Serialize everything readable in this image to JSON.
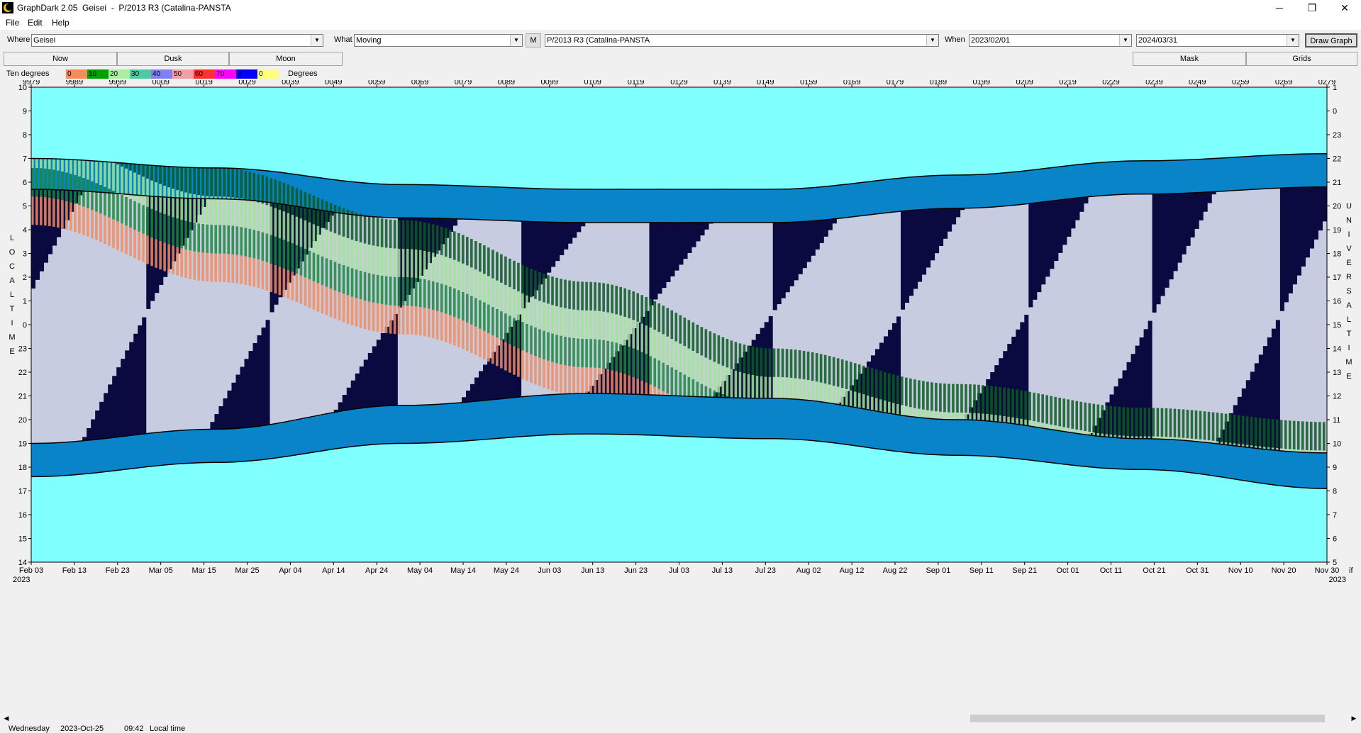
{
  "window": {
    "title": "GraphDark 2.05  Geisei  -  P/2013 R3 (Catalina-PANSTA",
    "minimize_glyph": "─",
    "maximize_glyph": "❐",
    "close_glyph": "✕"
  },
  "menu": [
    "File",
    "Edit",
    "Help"
  ],
  "toolbar": {
    "where_label": "Where",
    "where_value": "Geisei",
    "what_label": "What",
    "what_value": "Moving",
    "m_button": "M",
    "object_value": "P/2013 R3 (Catalina-PANSTA",
    "when_label": "When",
    "when_start": "2023/02/01",
    "when_end": "2024/03/31",
    "draw_button": "Draw Graph"
  },
  "tabs": [
    "Now",
    "Dusk",
    "Moon",
    "Mask",
    "Grids"
  ],
  "legend": {
    "label": "Ten degrees",
    "units": "Degrees",
    "steps": [
      {
        "label": "0",
        "color": "#f28c5f"
      },
      {
        "label": "10",
        "color": "#00a000"
      },
      {
        "label": "20",
        "color": "#a8f0a0"
      },
      {
        "label": "30",
        "color": "#50c8a0"
      },
      {
        "label": "40",
        "color": "#8080f0"
      },
      {
        "label": "50",
        "color": "#f0a0a0"
      },
      {
        "label": "60",
        "color": "#ff3030"
      },
      {
        "label": "70",
        "color": "#ff00ff"
      },
      {
        "label": "8",
        "color": "#0000ff"
      },
      {
        "label": "0",
        "color": "#ffff80"
      }
    ]
  },
  "chart_data": {
    "type": "heatmap",
    "colors": {
      "daylight": "#80ffff",
      "twilight": "#0a84c8",
      "dark_sky": "#0a0a40",
      "moonlit": "#c8cce0",
      "alt_0_10": "#f28c5f",
      "alt_10_20": "#1a8a3a",
      "alt_20_30": "#a0e890",
      "alt_30_plus": "#0a5a20"
    },
    "jd_prefix_left": "2450000+",
    "jd_prefix_right": "2460000+",
    "jd_labels": [
      "9979",
      "9989",
      "9999",
      "0009",
      "0019",
      "0029",
      "0039",
      "0049",
      "0059",
      "0069",
      "0079",
      "0089",
      "0099",
      "0109",
      "0119",
      "0129",
      "0139",
      "0149",
      "0159",
      "0169",
      "0179",
      "0189",
      "0199",
      "0209",
      "0219",
      "0229",
      "0239",
      "0249",
      "0259",
      "0269",
      "0279"
    ],
    "date_labels": [
      "Feb 03",
      "Feb 13",
      "Feb 23",
      "Mar 05",
      "Mar 15",
      "Mar 25",
      "Apr 04",
      "Apr 14",
      "Apr 24",
      "May 04",
      "May 14",
      "May 24",
      "Jun 03",
      "Jun 13",
      "Jun 23",
      "Jul 03",
      "Jul 13",
      "Jul 23",
      "Aug 02",
      "Aug 12",
      "Aug 22",
      "Sep 01",
      "Sep 11",
      "Sep 21",
      "Oct 01",
      "Oct 11",
      "Oct 21",
      "Oct 31",
      "Nov 10",
      "Nov 20",
      "Nov 30"
    ],
    "year_left": "2023",
    "year_right": "2023",
    "corner_right": "if",
    "left_axis_title": "LOCAL TIME",
    "right_axis_title": "UNIVERSAL TIME",
    "left_ticks": [
      "10",
      "9",
      "8",
      "7",
      "6",
      "5",
      "4",
      "3",
      "2",
      "1",
      "0",
      "23",
      "22",
      "21",
      "20",
      "19",
      "18",
      "17",
      "16",
      "15",
      "14"
    ],
    "right_ticks": [
      "1",
      "0",
      "23",
      "22",
      "21",
      "20",
      "19",
      "18",
      "17",
      "16",
      "15",
      "14",
      "13",
      "12",
      "11",
      "10",
      "9",
      "8",
      "7",
      "6",
      "5"
    ],
    "local_range_hours": [
      14,
      34
    ],
    "n_days": 304,
    "dusk_start": [
      19.0,
      19.6,
      20.6,
      21.1,
      20.9,
      20.0,
      19.2,
      18.6
    ],
    "dusk_end": [
      17.6,
      18.2,
      19.0,
      19.4,
      19.2,
      18.5,
      17.9,
      17.1
    ],
    "dawn_start": [
      29.7,
      29.3,
      28.5,
      28.3,
      28.3,
      28.9,
      29.5,
      29.8
    ],
    "dawn_end": [
      31.0,
      30.6,
      29.9,
      29.7,
      29.7,
      30.3,
      30.9,
      31.2
    ],
    "object_rise": [
      28.2,
      25.8,
      23.6,
      21.0,
      18.2,
      16.7,
      15.7,
      15.1
    ],
    "moon_period_days": 29.53,
    "new_moon_offset_days": 18
  },
  "status": {
    "weekday": "Wednesday",
    "date": "2023-Oct-25",
    "time": "09:42",
    "mode": "Local time"
  }
}
